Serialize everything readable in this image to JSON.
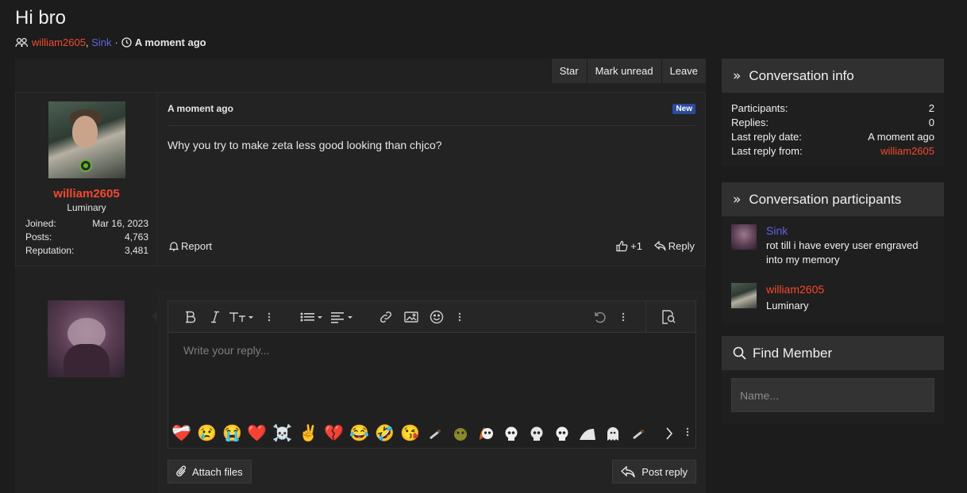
{
  "thread": {
    "title": "Hi bro",
    "participants": [
      "william2605",
      "Sink"
    ],
    "participants_sep": ",",
    "time_sep": "·",
    "time": "A moment ago"
  },
  "actions": {
    "star": "Star",
    "mark_unread": "Mark unread",
    "leave": "Leave"
  },
  "message": {
    "author": "william2605",
    "author_title": "Luminary",
    "stats": [
      {
        "label": "Joined:",
        "value": "Mar 16, 2023"
      },
      {
        "label": "Posts:",
        "value": "4,763"
      },
      {
        "label": "Reputation:",
        "value": "3,481"
      }
    ],
    "date": "A moment ago",
    "badge": "New",
    "text": "Why you try to make zeta less good looking than chjco?",
    "report_label": "Report",
    "reaction_count": "+1",
    "reply_label": "Reply"
  },
  "editor": {
    "placeholder": "Write your reply...",
    "attach_label": "Attach files",
    "post_label": "Post reply",
    "emojis": [
      "❤️‍🩹",
      "😢",
      "😭",
      "❤️",
      "☠️",
      "✌️",
      "💔",
      "😂",
      "🤣",
      "😘"
    ]
  },
  "sidebar": {
    "info": {
      "title": "Conversation info",
      "rows": [
        {
          "label": "Participants:",
          "value": "2"
        },
        {
          "label": "Replies:",
          "value": "0"
        },
        {
          "label": "Last reply date:",
          "value": "A moment ago"
        },
        {
          "label": "Last reply from:",
          "value": "william2605"
        }
      ]
    },
    "participants": {
      "title": "Conversation participants",
      "list": [
        {
          "name": "Sink",
          "subtitle": "rot till i have every user engraved into my memory"
        },
        {
          "name": "william2605",
          "subtitle": "Luminary"
        }
      ]
    },
    "find": {
      "title": "Find Member",
      "placeholder": "Name..."
    }
  },
  "colors": {
    "red_user": "#f4492f",
    "blue_user": "#5e63e6",
    "online": "#63b32e",
    "badge": "#2a4a9c"
  }
}
